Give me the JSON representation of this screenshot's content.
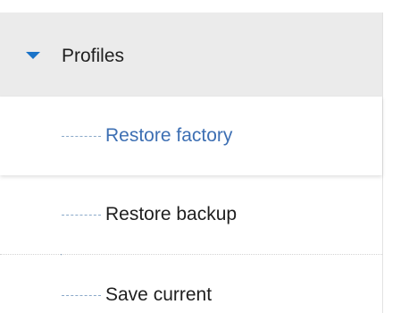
{
  "profiles_group": {
    "label": "Profiles",
    "expand_icon": "caret-down-icon",
    "accent_color": "#1a73c8",
    "items": [
      {
        "label": "Restore factory",
        "selected": true
      },
      {
        "label": "Restore backup",
        "selected": false
      },
      {
        "label": "Save current",
        "selected": false
      }
    ]
  }
}
